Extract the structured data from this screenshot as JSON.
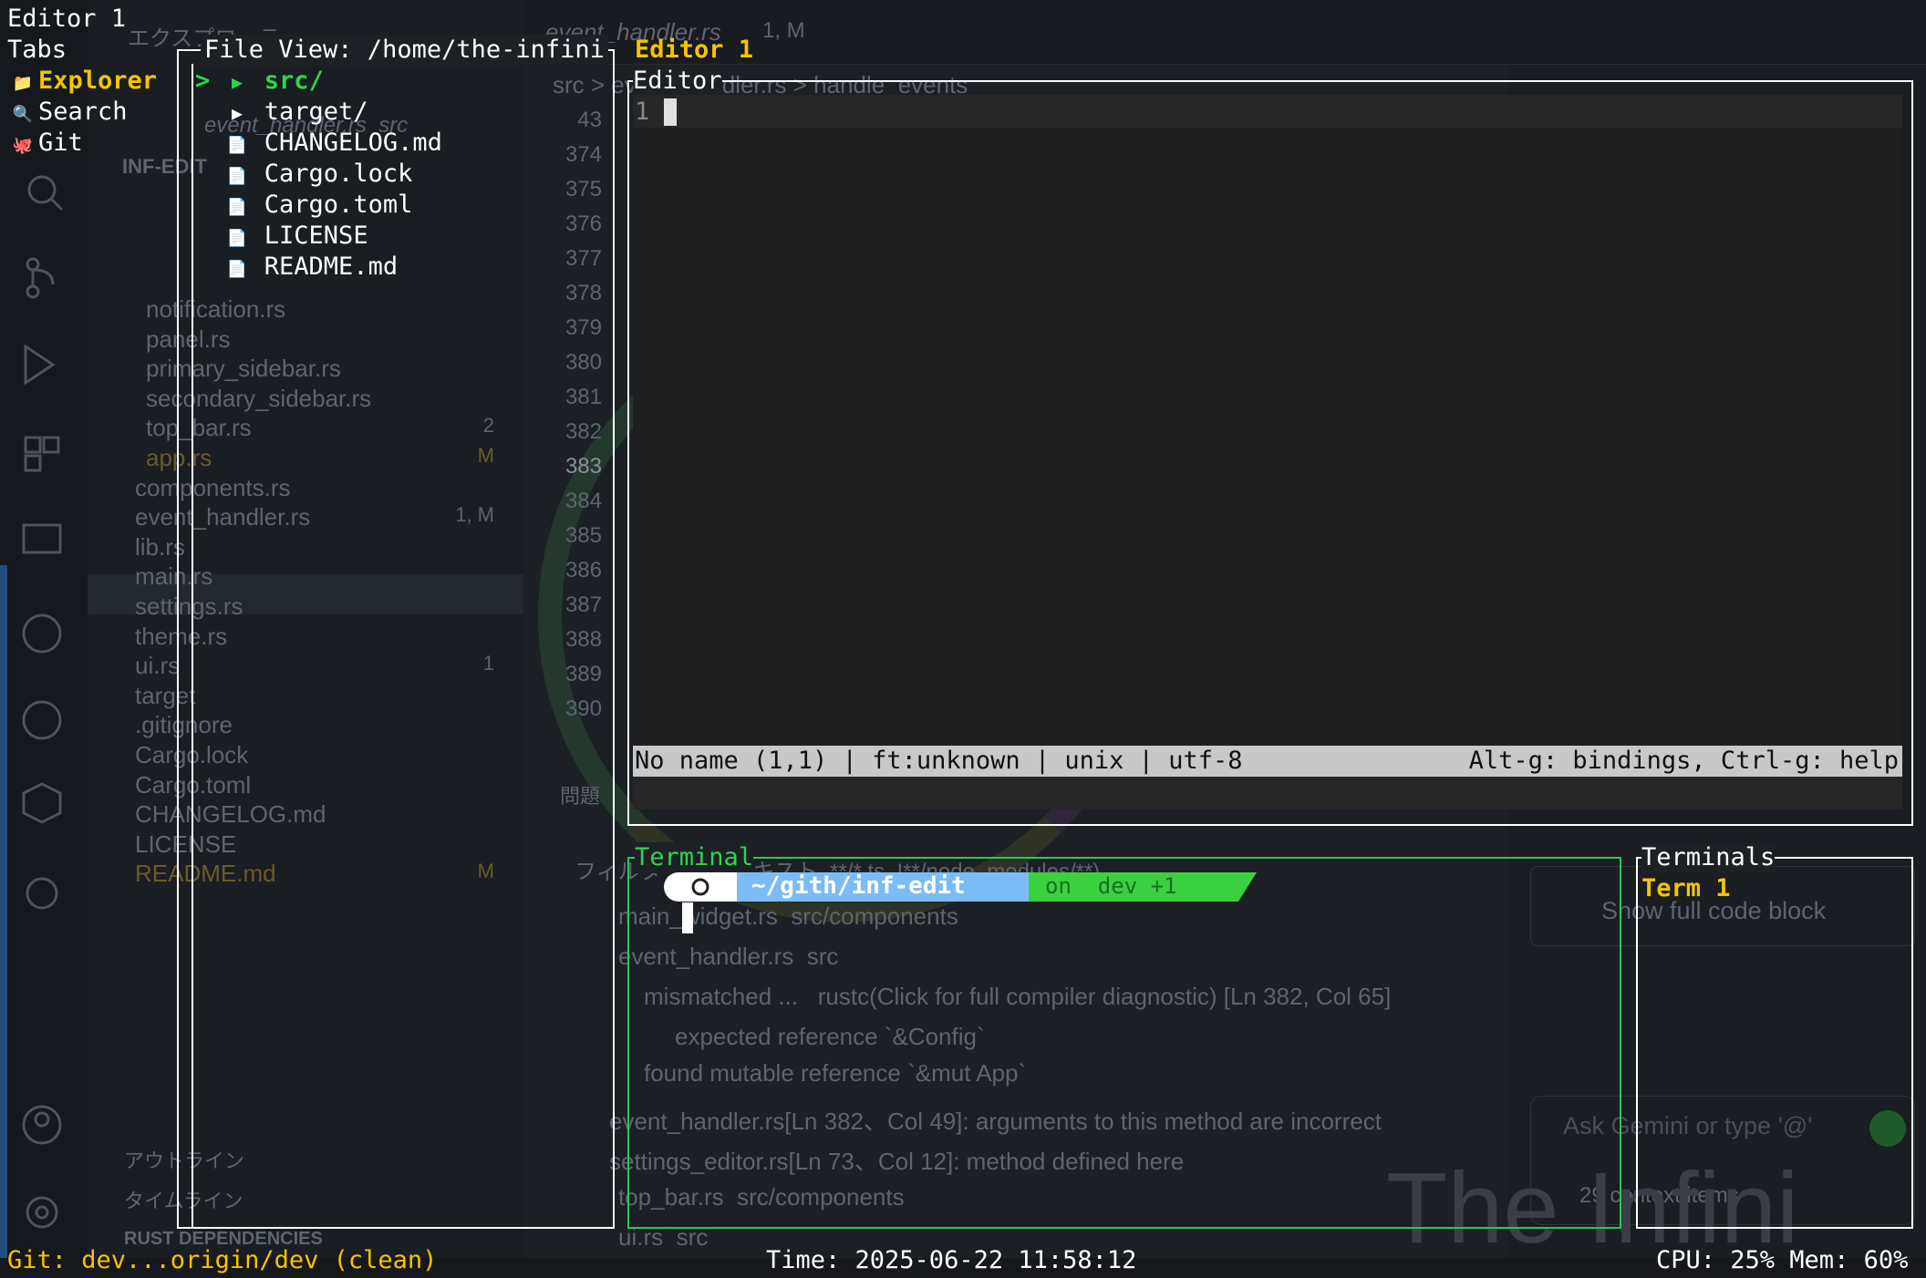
{
  "colors": {
    "accent_yellow": "#f5c400",
    "accent_green": "#2bd64f",
    "border_white": "#ffffff",
    "border_green": "#2ec55a",
    "statusline_bg": "#c8c8c8"
  },
  "background_vscode": {
    "tab_title": "event_handler.rs",
    "tab_badge": "1, M",
    "explorer_header": "エクスプローラー",
    "breadcrumb": "src > event_handler.rs > handle_events",
    "open_file": "event_handler.rs  src",
    "project": "INF-EDIT",
    "files": [
      {
        "name": "notification.rs",
        "badge": ""
      },
      {
        "name": "panel.rs",
        "badge": ""
      },
      {
        "name": "primary_sidebar.rs",
        "badge": ""
      },
      {
        "name": "secondary_sidebar.rs",
        "badge": ""
      },
      {
        "name": "top_bar.rs",
        "badge": "2"
      },
      {
        "name": "app.rs",
        "badge": "M"
      },
      {
        "name": "components.rs",
        "badge": ""
      },
      {
        "name": "event_handler.rs",
        "badge": "1, M"
      },
      {
        "name": "lib.rs",
        "badge": ""
      },
      {
        "name": "main.rs",
        "badge": ""
      },
      {
        "name": "settings.rs",
        "badge": ""
      },
      {
        "name": "theme.rs",
        "badge": ""
      },
      {
        "name": "ui.rs",
        "badge": "1"
      },
      {
        "name": "target",
        "badge": ""
      },
      {
        "name": ".gitignore",
        "badge": ""
      },
      {
        "name": "Cargo.lock",
        "badge": ""
      },
      {
        "name": "Cargo.toml",
        "badge": ""
      },
      {
        "name": "CHANGELOG.md",
        "badge": ""
      },
      {
        "name": "LICENSE",
        "badge": ""
      },
      {
        "name": "README.md",
        "badge": "M"
      }
    ],
    "outline": "アウトライン",
    "timeline": "タイムライン",
    "rust_deps": "RUST DEPENDENCIES",
    "line_numbers": [
      "43",
      "374",
      "375",
      "376",
      "377",
      "378",
      "379",
      "380",
      "381",
      "382",
      "383",
      "384",
      "385",
      "386",
      "387",
      "388",
      "389",
      "390"
    ],
    "problems_tab": "問題",
    "problems": [
      "main_widget.rs  src/components",
      "event_handler.rs  src",
      "mismatched ...   rustc(Click for full compiler diagnostic) [Ln 382, Col 65]",
      "expected reference `&Config`",
      "found mutable reference `&mut App`",
      "event_handler.rs[Ln 382、Col 49]: arguments to this method are incorrect",
      "settings_editor.rs[Ln 73、Col 12]: method defined here",
      "top_bar.rs  src/components",
      "ui.rs  src"
    ],
    "filter_placeholder": "フィルター (例: テキスト, **/*.ts, !**/node_modules/**)",
    "chat_show_code": "Show full code block",
    "chat_placeholder": "Ask Gemini or type '@'",
    "chat_context": "29 context items",
    "watermark": "The Infini"
  },
  "tui": {
    "title": "Editor 1",
    "tabs_label": "Tabs",
    "tabs": [
      {
        "icon": "folder-icon",
        "glyph": "📁",
        "label": "Explorer",
        "active": true
      },
      {
        "icon": "search-icon",
        "glyph": "🔍",
        "label": "Search",
        "active": false
      },
      {
        "icon": "git-icon",
        "glyph": "🐙",
        "label": "Git",
        "active": false
      }
    ],
    "file_view_title": "File View: /home/the-infini",
    "file_tree": [
      {
        "glyph": "▶",
        "name": "src/",
        "selected": true
      },
      {
        "glyph": "▶",
        "name": "target/",
        "selected": false
      },
      {
        "glyph": "📄",
        "name": "CHANGELOG.md",
        "selected": false
      },
      {
        "glyph": "📄",
        "name": "Cargo.lock",
        "selected": false
      },
      {
        "glyph": "📄",
        "name": "Cargo.toml",
        "selected": false
      },
      {
        "glyph": "📄",
        "name": "LICENSE",
        "selected": false
      },
      {
        "glyph": "📄",
        "name": "README.md",
        "selected": false
      }
    ],
    "selected_marker": ">",
    "editor_header": "Editor 1",
    "editor_box_title": "Editor",
    "editor_line_number": "1",
    "statusline_left": "No name (1,1) | ft:unknown | unix | utf-8",
    "statusline_right": "Alt-g: bindings, Ctrl-g: help",
    "terminal_title": "Terminal",
    "prompt_path": "~/gith/inf-edit",
    "prompt_git": "on  dev +1",
    "terminals_title": "Terminals",
    "terminal_items": [
      "Term 1"
    ],
    "git_status": "Git: dev...origin/dev (clean)",
    "time": "Time: 2025-06-22 11:58:12",
    "sysinfo": "CPU: 25% Mem: 60%"
  }
}
